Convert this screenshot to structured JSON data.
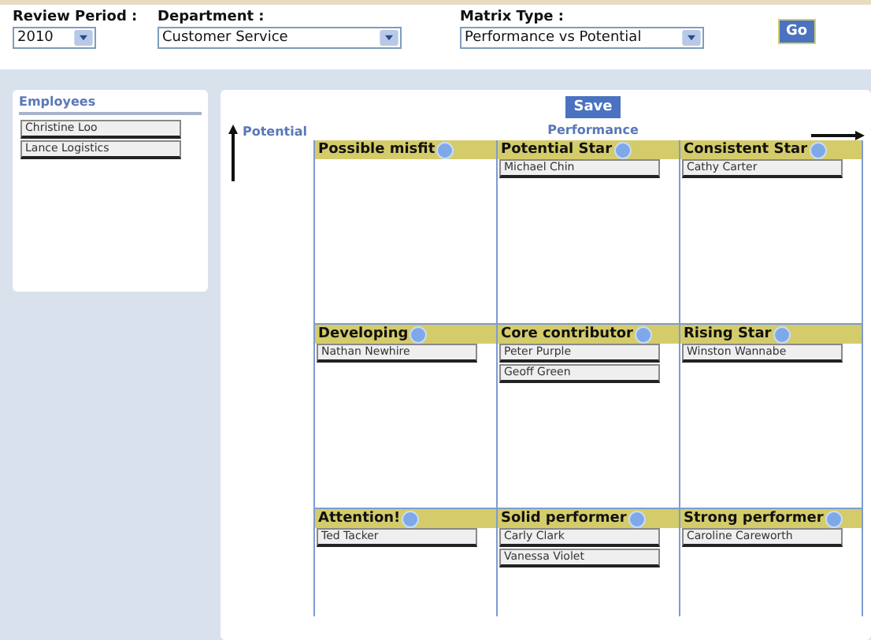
{
  "filters": [
    {
      "label": "Review Period :",
      "value": "2010"
    },
    {
      "label": "Department :",
      "value": "Customer Service"
    },
    {
      "label": "Matrix Type :",
      "value": "Performance vs Potential"
    }
  ],
  "go_button": "Go",
  "employees_panel": {
    "title": "Employees",
    "items": [
      "Christine Loo",
      "Lance Logistics"
    ]
  },
  "matrix": {
    "save_button": "Save",
    "x_axis_label": "Performance",
    "y_axis_label": "Potential",
    "cells": [
      {
        "title": "Possible misfit"
      },
      {
        "title": "Potential Star",
        "employees": [
          "Michael Chin"
        ]
      },
      {
        "title": "Consistent Star",
        "employees": [
          "Cathy Carter"
        ]
      },
      {
        "title": "Developing",
        "employees": [
          "Nathan Newhire"
        ]
      },
      {
        "title": "Core contributor",
        "employees": [
          "Peter Purple",
          "Geoff Green"
        ]
      },
      {
        "title": "Rising Star",
        "employees": [
          "Winston Wannabe"
        ]
      },
      {
        "title": "Attention!",
        "employees": [
          "Ted Tacker"
        ]
      },
      {
        "title": "Solid performer",
        "employees": [
          "Carly Clark",
          "Vanessa Violet"
        ]
      },
      {
        "title": "Strong performer",
        "employees": [
          "Caroline Careworth"
        ]
      }
    ]
  }
}
